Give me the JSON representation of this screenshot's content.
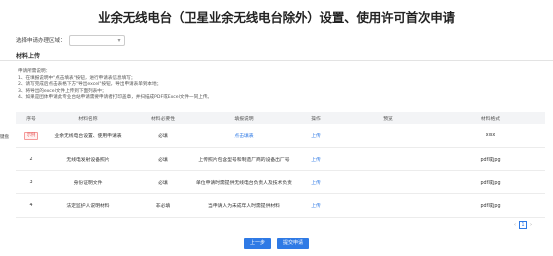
{
  "title": "业余无线电台（卫星业余无线电台除外）设置、使用许可首次申请",
  "region": {
    "label": "选择申请办理区域：",
    "value": ""
  },
  "section": {
    "title": "材料上传"
  },
  "instructions": [
    "申请所需说明：",
    "1、在填报说明中\"点击填表\"按钮，进行申请表信息填写；",
    "2、请写完成后点击表格下方\"导出excel\"按钮，导出申请表单到本地；",
    "3、将导出的excel文件上传到下面列表中；",
    "4、如果是团体申请此专业台站申请需要申请者打印盖章，并扫描成PDF或Excel文件一同上传。"
  ],
  "table": {
    "headers": [
      "序号",
      "材料名称",
      "材料必要性",
      "填报说明",
      "操作",
      "预览",
      "材料格式"
    ],
    "rows": [
      {
        "no": "",
        "tag": "示例",
        "name": "业余无线电台设置、使用申请表",
        "required": "必填",
        "note": "点击填表",
        "op": "上传",
        "preview": "",
        "format": "xlsx"
      },
      {
        "no": "2",
        "tag": "",
        "name": "无线电发射设备照片",
        "required": "必填",
        "note": "上传照片包含型号和制造厂商的设备出厂号",
        "op": "上传",
        "preview": "",
        "format": "pdf或jpg"
      },
      {
        "no": "3",
        "tag": "",
        "name": "身份证明文件",
        "required": "必填",
        "note": "单位申请时需提供无线电台负责人及技术负责人",
        "op": "上传",
        "preview": "",
        "format": "pdf或jpg"
      },
      {
        "no": "4",
        "tag": "",
        "name": "法定监护人说明材料",
        "required": "非必填",
        "note": "当申请人为未成年人时需提供材料",
        "op": "上传",
        "preview": "",
        "format": "pdf或jpg"
      }
    ]
  },
  "side_note": "键盘",
  "pager": {
    "prev": "‹",
    "page": "1",
    "next": "›"
  },
  "buttons": {
    "prev": "上一步",
    "submit": "提交申请"
  },
  "colors": {
    "accent": "#2f7ae5",
    "tag": "#e45656"
  }
}
